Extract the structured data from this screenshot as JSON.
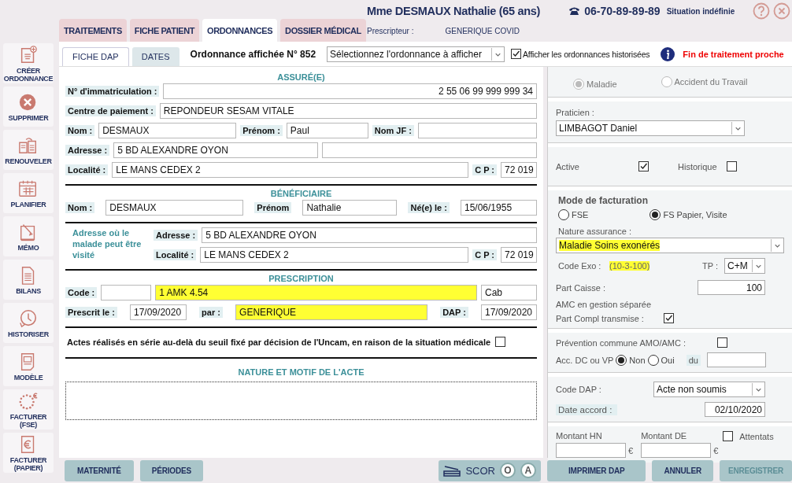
{
  "sidebar": [
    {
      "label": "CRÉER ORDONNANCE",
      "kind": "new-doc"
    },
    {
      "label": "SUPPRIMER",
      "kind": "delete"
    },
    {
      "label": "RENOUVELER",
      "kind": "renew"
    },
    {
      "label": "PLANIFIER",
      "kind": "calendar"
    },
    {
      "label": "MÉMO",
      "kind": "memo"
    },
    {
      "label": "BILANS",
      "kind": "report"
    },
    {
      "label": "HISTORISER",
      "kind": "history"
    },
    {
      "label": "MODÈLE",
      "kind": "template"
    },
    {
      "label": "FACTURER (FSE)",
      "kind": "euro-stars"
    },
    {
      "label": "FACTURER (PAPIER)",
      "kind": "euro-doc"
    }
  ],
  "tabs": [
    {
      "label": "TRAITEMENTS",
      "selected": false
    },
    {
      "label": "FICHE PATIENT",
      "selected": false
    },
    {
      "label": "ORDONNANCES",
      "selected": true
    },
    {
      "label": "DOSSIER MÉDICAL",
      "selected": false
    }
  ],
  "patient": {
    "name": "Mme DESMAUX Nathalie (65 ans)",
    "phone": "06-70-89-89-89",
    "situation": "Situation indéfinie",
    "prescriber_label": "Prescripteur :",
    "prescriber": "GENERIQUE COVID"
  },
  "subtabs": [
    {
      "label": "FICHE DAP",
      "selected": true
    },
    {
      "label": "DATES",
      "selected": false
    }
  ],
  "ordonnance": {
    "title": "Ordonnance affichée N° 852",
    "select": "Sélectionnez l'ordonnance à afficher",
    "history": {
      "label": "Afficher les ordonnances historisées",
      "checked": true
    },
    "alert": "Fin de traitement proche"
  },
  "form": [
    {
      "title": "ASSURÉ(E)",
      "rows": [
        {
          "parts": [
            {
              "kind": "label",
              "text": "N° d'immatriculation :"
            },
            {
              "kind": "field",
              "value": "2 55 06 99 999 999 34"
            }
          ]
        },
        {
          "parts": [
            {
              "kind": "label",
              "text": "Centre de paiement :"
            },
            {
              "kind": "field",
              "value": "REPONDEUR SESAM VITALE"
            }
          ]
        },
        {
          "parts": [
            {
              "kind": "label",
              "text": "Nom :"
            },
            {
              "kind": "field",
              "value": "DESMAUX"
            },
            {
              "kind": "label",
              "text": "Prénom :"
            },
            {
              "kind": "field",
              "value": "Paul"
            },
            {
              "kind": "label",
              "text": "Nom JF :"
            },
            {
              "kind": "field"
            }
          ]
        },
        {
          "parts": [
            {
              "kind": "label",
              "text": "Adresse :"
            },
            {
              "kind": "field",
              "value": "5 BD ALEXANDRE OYON"
            },
            {
              "kind": "field"
            }
          ]
        },
        {
          "parts": [
            {
              "kind": "label",
              "text": "Localité :"
            },
            {
              "kind": "field",
              "value": "LE MANS CEDEX 2"
            },
            {
              "kind": "label",
              "text": "C P :"
            },
            {
              "kind": "field",
              "value": "72 019"
            }
          ]
        }
      ]
    },
    {
      "title": "BÉNÉFICIAIRE",
      "rows": [
        {
          "parts": [
            {
              "kind": "label",
              "text": "Nom :"
            },
            {
              "kind": "field",
              "value": "DESMAUX"
            },
            {
              "kind": "label",
              "text": "Prénom"
            },
            {
              "kind": "field",
              "value": "Nathalie"
            },
            {
              "kind": "label",
              "text": "Né(e) le :"
            },
            {
              "kind": "field",
              "value": "15/06/1955"
            }
          ]
        }
      ]
    },
    {
      "caption": "Adresse où le malade peut être visité",
      "rows": [
        {
          "parts": [
            {
              "kind": "label",
              "text": "Adresse :"
            },
            {
              "kind": "field",
              "value": "5 BD ALEXANDRE OYON"
            }
          ]
        },
        {
          "parts": [
            {
              "kind": "label",
              "text": "Localité :"
            },
            {
              "kind": "field",
              "value": "LE MANS CEDEX 2"
            },
            {
              "kind": "label",
              "text": "C P :"
            },
            {
              "kind": "field",
              "value": "72 019"
            }
          ]
        }
      ]
    },
    {
      "title": "PRESCRIPTION",
      "rows": [
        {
          "parts": [
            {
              "kind": "label",
              "text": "Code :"
            },
            {
              "kind": "field",
              "highlighted": false
            },
            {
              "kind": "field",
              "value": "1 AMK 4.54",
              "highlighted": true
            },
            {
              "kind": "field",
              "value": "Cab",
              "highlighted": false
            }
          ]
        },
        {
          "parts": [
            {
              "kind": "label",
              "text": "Prescrit le :"
            },
            {
              "kind": "field",
              "value": "17/09/2020",
              "highlighted": false
            },
            {
              "kind": "label",
              "text": "par :"
            },
            {
              "kind": "field",
              "value": "GENERIQUE",
              "highlighted": true
            },
            {
              "kind": "label",
              "text": "DAP :"
            },
            {
              "kind": "field",
              "value": "17/09/2020",
              "highlighted": false
            }
          ]
        }
      ]
    }
  ],
  "series": {
    "label": "Actes réalisés en série au-delà du seuil fixé par décision de l'Uncam, en raison de la situation médicale",
    "checked": false
  },
  "nature": {
    "title": "NATURE ET MOTIF DE L'ACTE"
  },
  "right_panel": {
    "insurance_type": [
      {
        "label": "Maladie",
        "selected": true,
        "disabled": true
      },
      {
        "label": "Accident du Travail",
        "selected": false,
        "disabled": true
      }
    ],
    "practitioner": {
      "label": "Praticien :",
      "value": "LIMBAGOT Daniel"
    },
    "status": [
      {
        "label": "Active",
        "checked": true
      },
      {
        "label": "Historique",
        "checked": false
      }
    ],
    "billing": {
      "title": "Mode de facturation",
      "modes": [
        {
          "label": "FSE",
          "selected": false,
          "disabled": false
        },
        {
          "label": "FS Papier, Visite",
          "selected": true,
          "disabled": false
        }
      ],
      "insurance_nature": {
        "label": "Nature assurance :",
        "value": "Maladie Soins exonérés",
        "highlighted": true
      },
      "exo": {
        "label": "Code Exo :",
        "value": "(10-3-100)",
        "highlighted": true
      },
      "tp": {
        "label": "TP :",
        "value": "C+M"
      },
      "part_caisse": {
        "label": "Part Caisse :",
        "value": "100"
      },
      "amc_note": "AMC en gestion séparée",
      "part_compl": {
        "label": "Part Compl transmise :",
        "checked": true
      }
    },
    "prevention": {
      "label": "Prévention commune AMO/AMC :",
      "checked": false
    },
    "accident": {
      "label": "Acc. DC ou VP",
      "options": [
        {
          "label": "Non",
          "selected": true,
          "disabled": false
        },
        {
          "label": "Oui",
          "selected": false,
          "disabled": false
        }
      ],
      "date_label": "du"
    },
    "dap": {
      "label": "Code DAP :",
      "value": "Acte non soumis",
      "date_label": "Date accord :",
      "date": "02/10/2020"
    },
    "amounts": [
      {
        "label": "Montant HN",
        "currency": "€"
      },
      {
        "label": "Montant DE",
        "currency": "€"
      }
    ],
    "attentats": {
      "label": "Attentats",
      "checked": false
    }
  },
  "bottom": {
    "left_buttons": [
      {
        "label": "MATERNITÉ",
        "disabled": false
      },
      {
        "label": "PÉRIODES",
        "disabled": false
      }
    ],
    "scor": {
      "label": "SCOR",
      "circles": [
        "O",
        "A"
      ]
    },
    "right_buttons": [
      {
        "label": "IMPRIMER DAP",
        "disabled": false
      },
      {
        "label": "ANNULER",
        "disabled": false
      },
      {
        "label": "ENREGISTRER",
        "disabled": true
      }
    ]
  }
}
